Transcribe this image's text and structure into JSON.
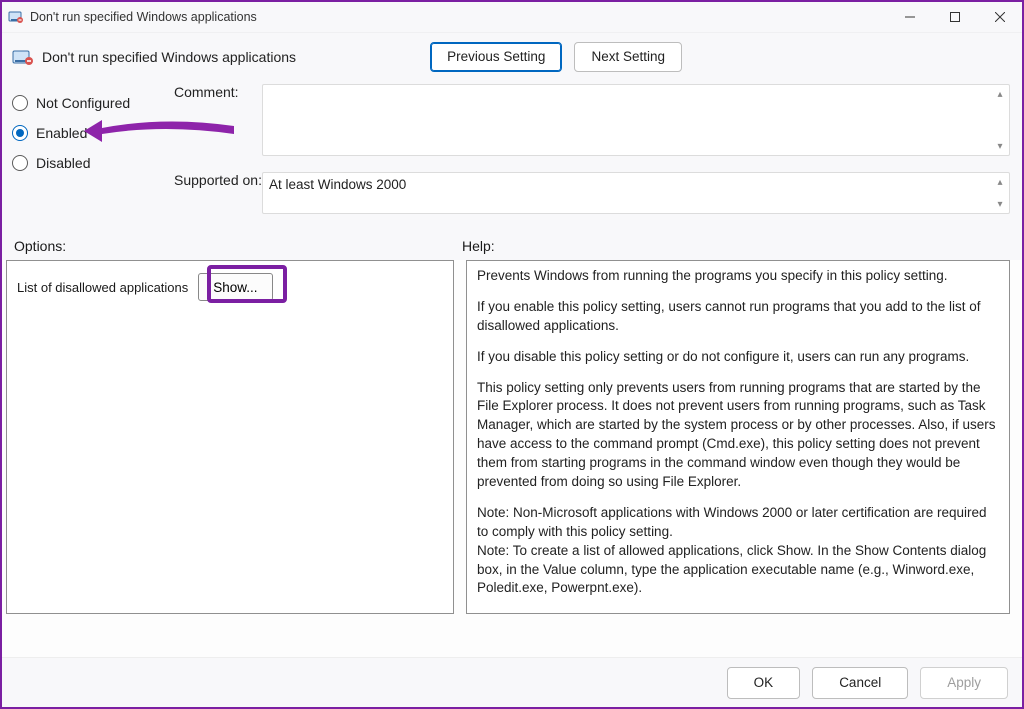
{
  "window": {
    "title": "Don't run specified Windows applications"
  },
  "header": {
    "policy_title": "Don't run specified Windows applications",
    "prev_btn": "Previous Setting",
    "next_btn": "Next Setting"
  },
  "settings": {
    "radio": {
      "not_configured": "Not Configured",
      "enabled": "Enabled",
      "disabled": "Disabled",
      "selected": "enabled"
    },
    "comment_label": "Comment:",
    "comment_value": "",
    "supported_label": "Supported on:",
    "supported_value": "At least Windows 2000"
  },
  "options": {
    "section_label": "Options:",
    "row_label": "List of disallowed applications",
    "show_btn": "Show..."
  },
  "help": {
    "section_label": "Help:",
    "p1": "Prevents Windows from running the programs you specify in this policy setting.",
    "p2": "If you enable this policy setting, users cannot run programs that you add to the list of disallowed applications.",
    "p3": "If you disable this policy setting or do not configure it, users can run any programs.",
    "p4": "This policy setting only prevents users from running programs that are started by the File Explorer process. It does not prevent users from running programs, such as Task Manager, which are started by the system process or by other processes.  Also, if users have access to the command prompt (Cmd.exe), this policy setting does not prevent them from starting programs in the command window even though they would be prevented from doing so using File Explorer.",
    "p5": "Note: Non-Microsoft applications with Windows 2000 or later certification are required to comply with this policy setting.",
    "p6": "Note: To create a list of allowed applications, click Show.  In the Show Contents dialog box, in the Value column, type the application executable name (e.g., Winword.exe, Poledit.exe, Powerpnt.exe)."
  },
  "footer": {
    "ok": "OK",
    "cancel": "Cancel",
    "apply": "Apply"
  }
}
